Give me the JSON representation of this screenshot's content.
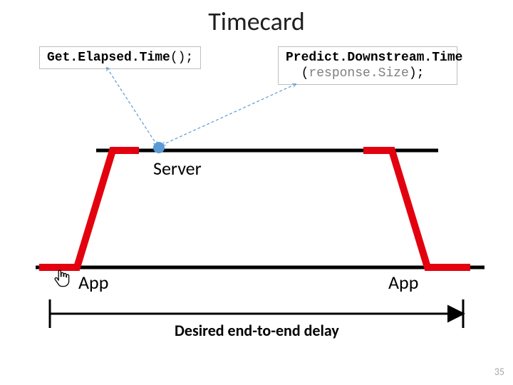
{
  "title": "Timecard",
  "left_code": {
    "method": "Get.Elapsed.Time",
    "params": "();"
  },
  "right_code": {
    "method": "Predict.Downstream.Time",
    "indent_pad": "  ",
    "open_paren": "(",
    "param": "response.Size",
    "close_paren": ");"
  },
  "labels": {
    "server": "Server",
    "app_left": "App",
    "app_right": "App",
    "delay": "Desired end-to-end delay"
  },
  "pagenum": "35"
}
